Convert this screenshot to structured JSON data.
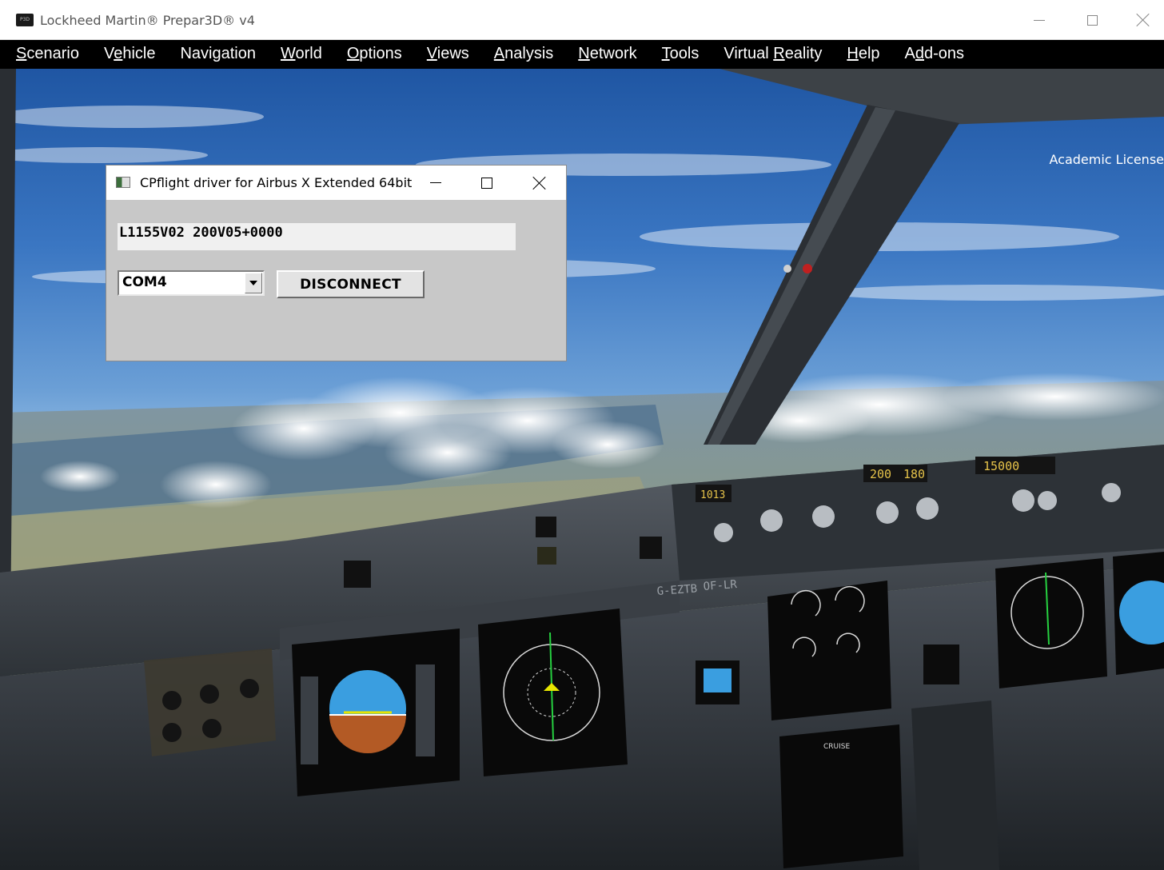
{
  "window": {
    "icon_text": "P3D",
    "title": "Lockheed Martin® Prepar3D® v4"
  },
  "menu": [
    {
      "pre": "",
      "key": "S",
      "post": "cenario"
    },
    {
      "pre": "V",
      "key": "e",
      "post": "hicle"
    },
    {
      "pre": "Navi",
      "key": "g",
      "post": "ation"
    },
    {
      "pre": "",
      "key": "W",
      "post": "orld"
    },
    {
      "pre": "",
      "key": "O",
      "post": "ptions"
    },
    {
      "pre": "",
      "key": "V",
      "post": "iews"
    },
    {
      "pre": "",
      "key": "A",
      "post": "nalysis"
    },
    {
      "pre": "",
      "key": "N",
      "post": "etwork"
    },
    {
      "pre": "",
      "key": "T",
      "post": "ools"
    },
    {
      "pre": "Virtual ",
      "key": "R",
      "post": "eality"
    },
    {
      "pre": "",
      "key": "H",
      "post": "elp"
    },
    {
      "pre": "A",
      "key": "d",
      "post": "d-ons"
    }
  ],
  "viewport": {
    "license_text": "Academic License",
    "cockpit_labels": {
      "reg_left": "G-EZTB",
      "reg_right": "OF-LR",
      "fcu_speed": "200",
      "fcu_heading": "180",
      "fcu_altitude": "15000",
      "baro_left": "1013",
      "ecam_mode": "CRUISE"
    }
  },
  "dialog": {
    "title": "CPflight driver for Airbus X Extended 64bit",
    "status": "L1155V02 200V05+0000",
    "port": "COM4",
    "disconnect_label": "DISCONNECT"
  },
  "colors": {
    "menubar": "#000000",
    "dialog_bg": "#c8c8c8",
    "sky_top": "#1f56a3",
    "panel": "#2a2e33"
  }
}
